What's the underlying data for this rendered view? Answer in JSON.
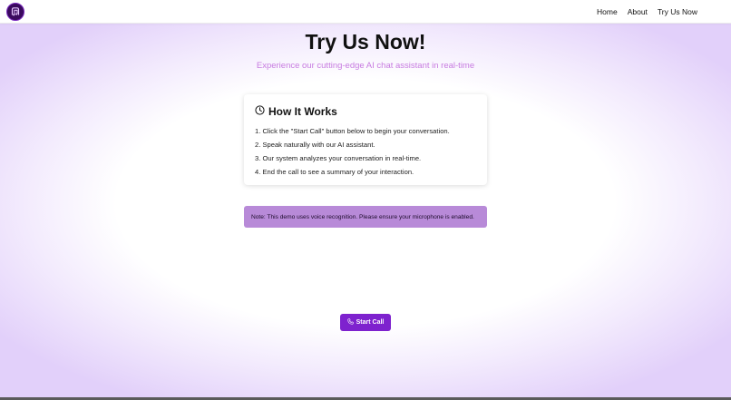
{
  "nav": {
    "logo_icon": "logo-music-icon",
    "links": [
      "Home",
      "About",
      "Try Us Now"
    ]
  },
  "hero": {
    "title": "Try Us Now!",
    "subtitle": "Experience our cutting-edge AI chat assistant in real-time"
  },
  "how_it_works": {
    "icon": "clock-icon",
    "title": "How It Works",
    "steps": [
      "1. Click the \"Start Call\" button below to begin your conversation.",
      "2. Speak naturally with our AI assistant.",
      "3. Our system analyzes your conversation in real-time.",
      "4. End the call to see a summary of your interaction."
    ]
  },
  "note": {
    "text": "Note: This demo uses voice recognition. Please ensure your microphone is enabled."
  },
  "call": {
    "icon": "phone-icon",
    "label": "Start Call"
  },
  "colors": {
    "accent": "#7e22ce",
    "subtitle": "#c77be0",
    "note_bg": "#b88ad8",
    "logo_bg": "#3a0a5e"
  }
}
